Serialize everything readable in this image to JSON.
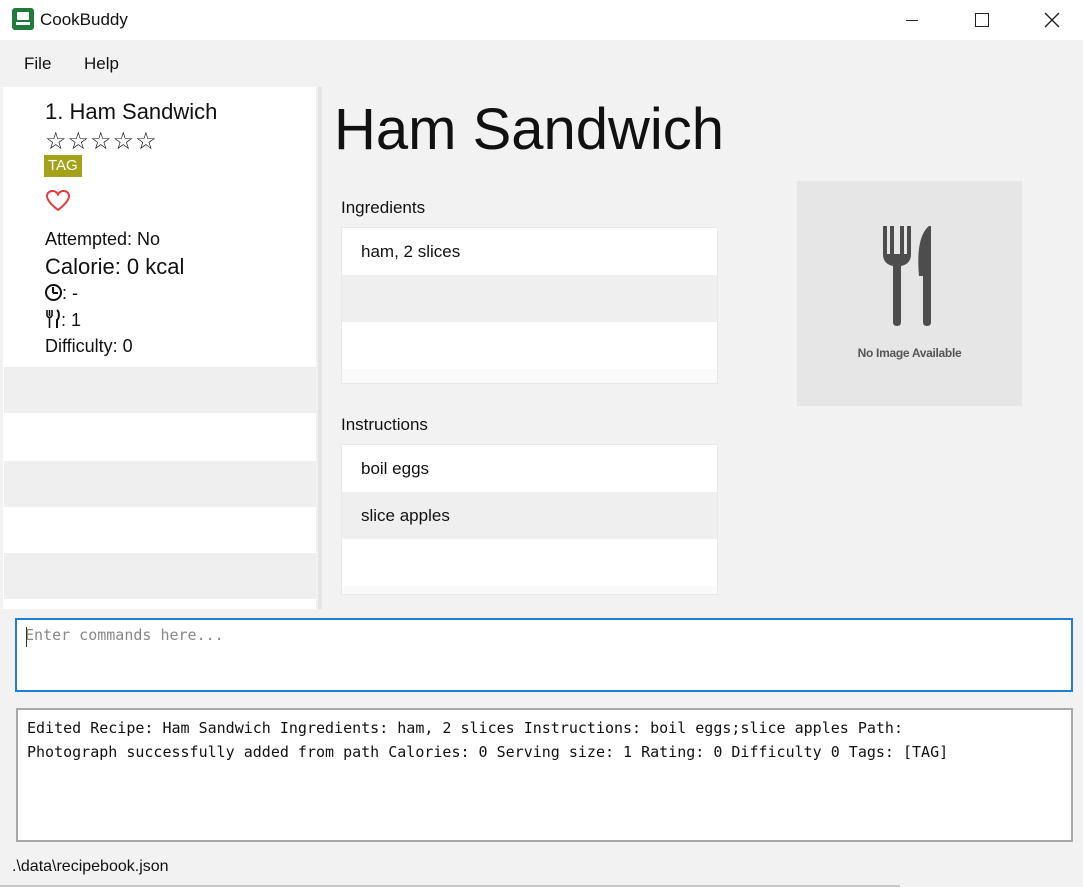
{
  "window": {
    "title": "CookBuddy",
    "minimize_icon": "minimize-icon",
    "maximize_icon": "maximize-icon",
    "close_icon": "close-icon"
  },
  "menu": {
    "file": "File",
    "help": "Help"
  },
  "recipe_card": {
    "title": "1.  Ham Sandwich",
    "rating_stars": "☆☆☆☆☆",
    "tag": "TAG",
    "favourite_icon": "heart-icon",
    "attempted": "Attempted: No",
    "calorie": "Calorie: 0 kcal",
    "time": ": -",
    "serving": ": 1",
    "difficulty": "Difficulty: 0"
  },
  "detail": {
    "title": "Ham Sandwich",
    "ingredients_label": "Ingredients",
    "ingredients": [
      "ham, 2 slices"
    ],
    "instructions_label": "Instructions",
    "instructions": [
      "boil eggs",
      "slice apples"
    ],
    "no_image_text": "No Image Available"
  },
  "command": {
    "placeholder": "Enter commands here..."
  },
  "result": {
    "line1": "Edited Recipe: Ham Sandwich Ingredients: ham, 2 slices Instructions: boil eggs;slice apples Path:",
    "line2": "Photograph successfully added from path Calories: 0 Serving size: 1 Rating: 0 Difficulty 0 Tags: [TAG]"
  },
  "status": {
    "path": ".\\data\\recipebook.json"
  },
  "colors": {
    "tag": "#a4a21a",
    "heart": "#e23b3b",
    "command_border": "#1e7fd6"
  }
}
